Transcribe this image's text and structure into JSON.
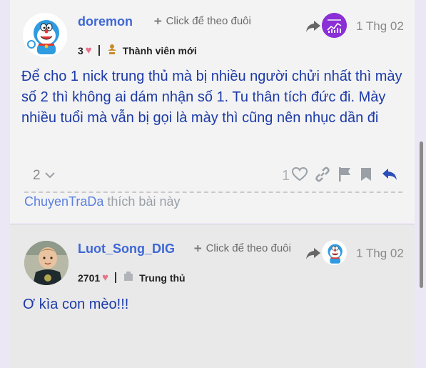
{
  "post1": {
    "username": "doremon",
    "follow_label": "Click để theo đuôi",
    "date": "1 Thg 02",
    "reply_avatar_caption": "",
    "likes_count": "3",
    "rank": "Thành viên mới",
    "body": "Để cho 1 nick trung thủ mà bị nhiều người chửi nhất thì mày số 2 thì không ai dám nhận số 1. Tu thân tích đức đi. Mày nhiều tuổi mà vẫn bị gọi là mày thì cũng nên nhục dần đi",
    "replies_count": "2",
    "like_count": "1",
    "liked_by": "ChuyenTraDa",
    "liked_suffix": "thích bài này"
  },
  "post2": {
    "username": "Luot_Song_DIG",
    "follow_label": "Click để theo đuôi",
    "date": "1 Thg 02",
    "likes_count": "2701",
    "rank": "Trung thủ",
    "body": "Ơ kìa con mèo!!!"
  },
  "icons": {
    "follow": "user-plus-icon",
    "reply": "share-arrow-icon",
    "heart": "heart-icon",
    "badge": "medal-icon",
    "link": "link-icon",
    "flag": "flag-icon",
    "bookmark": "bookmark-icon",
    "reply_action": "reply-icon",
    "chevron": "chevron-down-icon"
  },
  "colors": {
    "username": "#3e67d6",
    "body_text": "#1c3aa8",
    "heart": "#e8718a",
    "reply_action": "#2b4fb8",
    "background": "#ece7f4"
  }
}
